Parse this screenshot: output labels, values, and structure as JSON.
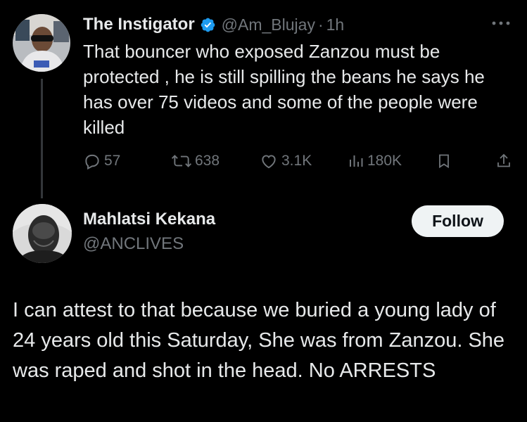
{
  "tweet": {
    "author_name": "The Instigator",
    "handle": "@Am_Blujay",
    "separator": "·",
    "time": "1h",
    "text": "That bouncer who exposed Zanzou must be protected , he is still spilling the beans he says he has over 75 videos and some of the people were killed",
    "stats": {
      "replies": "57",
      "reposts": "638",
      "likes": "3.1K",
      "views": "180K"
    },
    "icons": {
      "verified": "verified-badge-icon",
      "more": "more-options-icon",
      "reply": "reply-bubble-icon",
      "repost": "repost-icon",
      "like": "heart-icon",
      "views": "views-chart-icon",
      "bookmark": "bookmark-icon",
      "share": "share-icon"
    }
  },
  "reply": {
    "author_name": "Mahlatsi Kekana",
    "handle": "@ANCLIVES",
    "follow_label": "Follow",
    "text": "I can attest to that because we buried a young lady of 24 years old this Saturday, She was from Zanzou. She was raped and shot in the head. No ARRESTS"
  },
  "colors": {
    "background": "#000000",
    "primary_text": "#e7e9ea",
    "secondary_text": "#71767b",
    "verified_blue": "#1d9bf0",
    "follow_button_bg": "#eff3f4",
    "follow_button_text": "#0f1419",
    "thread_line": "#333639"
  }
}
